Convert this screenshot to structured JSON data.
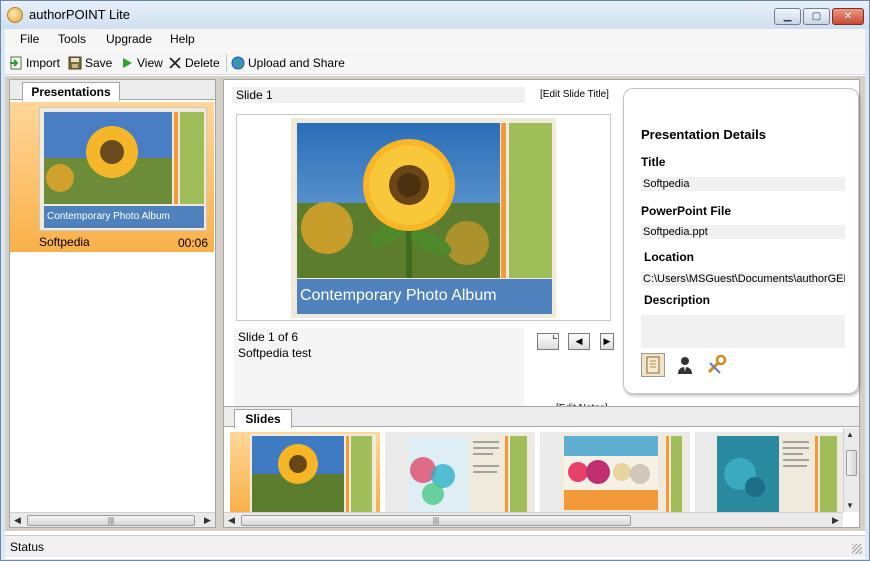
{
  "window": {
    "title": "authorPOINT Lite"
  },
  "menu": [
    "File",
    "Tools",
    "Upgrade",
    "Help"
  ],
  "toolbar": {
    "import_label": "Import",
    "save_label": "Save",
    "view_label": "View",
    "delete_label": "Delete",
    "upload_label": "Upload and Share"
  },
  "presentations": {
    "tab_label": "Presentations",
    "items": [
      {
        "name": "Softpedia",
        "duration": "00:06",
        "thumb_caption": "Contemporary Photo Album"
      }
    ]
  },
  "editor": {
    "slide_label": "Slide 1",
    "edit_title_link": "[Edit Slide Title]",
    "slide_caption": "Contemporary Photo Album",
    "slide_counter": "Slide 1 of 6",
    "slide_notes": "Softpedia test",
    "edit_notes_link": "[Edit Notes]"
  },
  "details": {
    "heading": "Presentation Details",
    "title_label": "Title",
    "title_value": "Softpedia",
    "file_label": "PowerPoint File",
    "file_value": "Softpedia.ppt",
    "location_label": "Location",
    "location_value": "C:\\Users\\MSGuest\\Documents\\authorGEN",
    "description_label": "Description",
    "description_value": ""
  },
  "slides": {
    "tab_label": "Slides",
    "count": 4
  },
  "status": {
    "text": "Status"
  },
  "colors": {
    "accent_blue": "#4f81bd",
    "accent_green": "#9fbe5a",
    "accent_orange": "#f29a3a",
    "selection": "#f9b048"
  }
}
